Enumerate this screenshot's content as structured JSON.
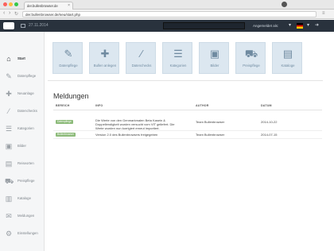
{
  "browser": {
    "tab_title": "der.bullenbrowser.de",
    "url": "der.bullenbrowser.de/neu/start.php"
  },
  "topbar": {
    "date": "27.11.2014",
    "logged_in_label": "Angemeldet als:"
  },
  "sidebar": {
    "items": [
      {
        "label": "Start",
        "icon": "home-icon",
        "active": true
      },
      {
        "label": "Datenpflege",
        "icon": "edit-icon"
      },
      {
        "label": "Neuanlage",
        "icon": "plus-icon"
      },
      {
        "label": "Datenchecks",
        "icon": "wand-icon"
      },
      {
        "label": "Kategorien",
        "icon": "list-icon"
      },
      {
        "label": "Bilder",
        "icon": "image-icon"
      },
      {
        "label": "Reiseorten",
        "icon": "document-icon"
      },
      {
        "label": "Preispflege",
        "icon": "cart-icon"
      },
      {
        "label": "Kataloge",
        "icon": "book-icon"
      },
      {
        "label": "Meldungen",
        "icon": "chat-icon"
      },
      {
        "label": "Einstellungen",
        "icon": "gears-icon"
      }
    ]
  },
  "tiles": [
    {
      "label": "Datenpflege",
      "icon": "edit-icon",
      "glyph": "✎"
    },
    {
      "label": "Bullen anlegen",
      "icon": "plus-icon",
      "glyph": "✚"
    },
    {
      "label": "Datenchecks",
      "icon": "wand-icon",
      "glyph": "⁄"
    },
    {
      "label": "Kategorien",
      "icon": "list-icon",
      "glyph": "☰"
    },
    {
      "label": "Bilder",
      "icon": "image-icon",
      "glyph": "▣"
    },
    {
      "label": "Preispflege",
      "icon": "cart-icon",
      "glyph": "⛟"
    },
    {
      "label": "Kataloge",
      "icon": "book-icon",
      "glyph": "▤"
    }
  ],
  "messages": {
    "title": "Meldungen",
    "columns": {
      "bereich": "BEREICH",
      "info": "INFO",
      "author": "AUTHOR",
      "datum": "DATUM"
    },
    "rows": [
      {
        "badge": "Datenpflege",
        "info_line1": "Die Werte von den Genmarkmalen Beta Kasein &",
        "info_line2": "Doppellendigkeit wurden versucht vom VIT geliefert. Die",
        "info_line3": "Werte wurden nun korrigiert erneut importiert.",
        "author": "Team Bullenbrowser",
        "date": "2014-10-22"
      },
      {
        "badge": "Bullenbrowser",
        "info_line1": "Version 2.0 des Bullenbrowsers freigegeben",
        "author": "Team Bullenbrowser",
        "date": "2014-07-15"
      }
    ]
  },
  "colors": {
    "topbar": "#29323d",
    "tile_bg": "#dce7f0",
    "tile_fg": "#6f8aa0",
    "badge": "#8dbb7a"
  }
}
